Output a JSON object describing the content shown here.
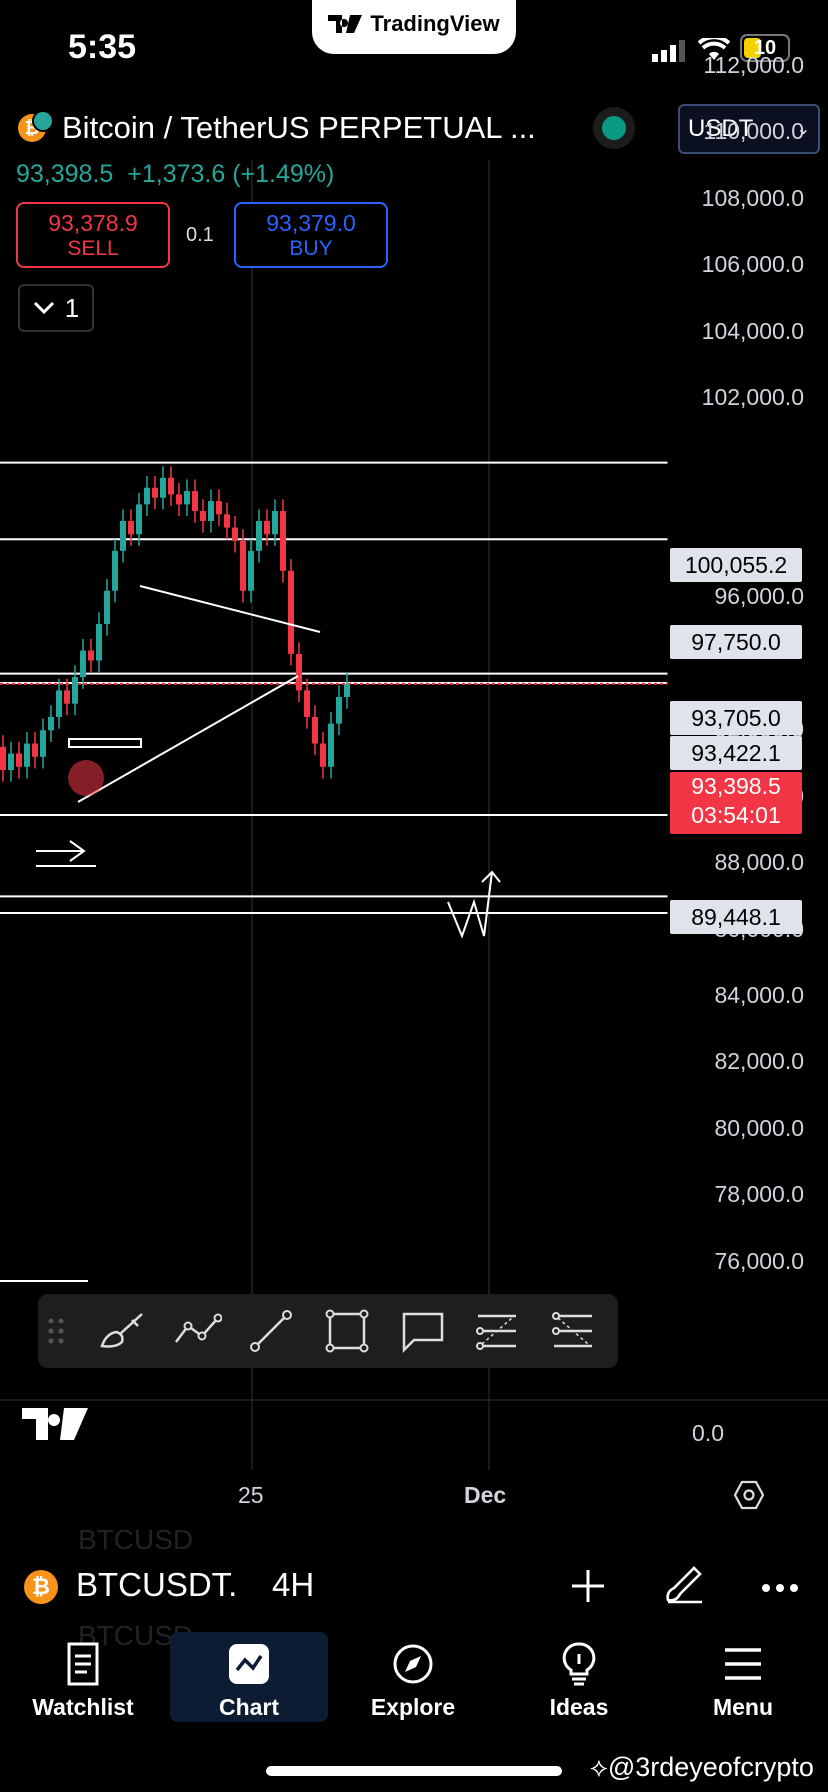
{
  "status_bar": {
    "time": "5:35",
    "battery": "10",
    "center_app": "TradingView"
  },
  "header": {
    "symbol_title": "Bitcoin / TetherUS PERPETUAL ...",
    "last_price": "93,398.5",
    "change": "+1,373.6 (+1.49%)",
    "currency": "USDT",
    "sell_price": "93,378.9",
    "sell_label": "SELL",
    "buy_price": "93,379.0",
    "buy_label": "BUY",
    "quantity": "0.1",
    "collapse_count": "1"
  },
  "price_axis": {
    "labels": [
      "112,000.0",
      "110,000.0",
      "108,000.0",
      "106,000.0",
      "104,000.0",
      "102,000.0",
      "96,000.0",
      "92,000.0",
      "90,000.0",
      "88,000.0",
      "86,000.0",
      "84,000.0",
      "82,000.0",
      "80,000.0",
      "78,000.0",
      "76,000.0"
    ],
    "zero_label": "0.0",
    "tags": [
      "100,055.2",
      "97,750.0",
      "93,705.0",
      "93,422.1",
      "89,448.1"
    ],
    "current_price_tag": "93,398.5",
    "countdown": "03:54:01"
  },
  "time_axis": {
    "labels": [
      "25",
      "Dec"
    ]
  },
  "drawing_toolbar": {
    "tools": [
      "drag-handle-icon",
      "brush-icon",
      "polyline-icon",
      "trendline-icon",
      "rectangle-icon",
      "callout-icon",
      "fib-retracement-icon",
      "long-position-icon"
    ]
  },
  "symbol_row": {
    "symbol": "BTCUSDT.",
    "interval": "4H",
    "ghost_top": "BTCUSD",
    "ghost_bottom": "BTCUSD",
    "currency_icon": "bitcoin-icon"
  },
  "bottom_nav": {
    "items": [
      "Watchlist",
      "Chart",
      "Explore",
      "Ideas",
      "Menu"
    ],
    "active": "Chart"
  },
  "watermark": "@3rdeyeofcrypto",
  "colors": {
    "up": "#26a69a",
    "down": "#f23645",
    "buy": "#2962ff",
    "background": "#000000",
    "active_nav": "#0c1d33"
  },
  "chart_data": {
    "type": "candlestick",
    "interval": "4H",
    "price_range": [
      75000,
      113000
    ],
    "horizontal_levels": [
      100055.2,
      97750.0,
      93705.0,
      93422.1,
      93398.5,
      89448.1,
      87000,
      86500
    ],
    "current_price": 93398.5
  }
}
